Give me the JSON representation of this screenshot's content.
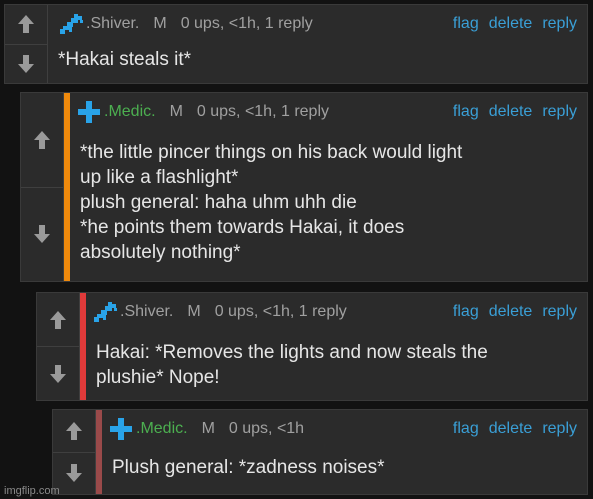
{
  "comments": [
    {
      "username": ".Shiver.",
      "user_color": "#a0a0a0",
      "icon": "blue-pixel-creature-icon",
      "mod_badge": "M",
      "meta": "0 ups, <1h, 1 reply",
      "actions": {
        "flag": "flag",
        "delete": "delete",
        "reply": "reply"
      },
      "lines": [
        "*Hakai steals it*"
      ],
      "accent": ""
    },
    {
      "username": ".Medic.",
      "user_color": "#4caf50",
      "icon": "blue-cross-icon",
      "mod_badge": "M",
      "meta": "0 ups, <1h, 1 reply",
      "actions": {
        "flag": "flag",
        "delete": "delete",
        "reply": "reply"
      },
      "lines": [
        "*the little pincer things on his back would light",
        "up like a flashlight*",
        "plush general: haha uhm uhh die",
        "*he points them towards Hakai, it does",
        "absolutely nothing*"
      ],
      "accent": "#f08a0c"
    },
    {
      "username": ".Shiver.",
      "user_color": "#a0a0a0",
      "icon": "blue-pixel-creature-icon",
      "mod_badge": "M",
      "meta": "0 ups, <1h, 1 reply",
      "actions": {
        "flag": "flag",
        "delete": "delete",
        "reply": "reply"
      },
      "lines": [
        "Hakai: *Removes the lights and now steals the",
        "plushie* Nope!"
      ],
      "accent": "#e03a3a"
    },
    {
      "username": ".Medic.",
      "user_color": "#4caf50",
      "icon": "blue-cross-icon",
      "mod_badge": "M",
      "meta": "0 ups, <1h",
      "actions": {
        "flag": "flag",
        "delete": "delete",
        "reply": "reply"
      },
      "lines": [
        "Plush general: *zadness noises*"
      ],
      "accent": "#9a4a4a"
    }
  ],
  "watermark": "imgflip.com"
}
